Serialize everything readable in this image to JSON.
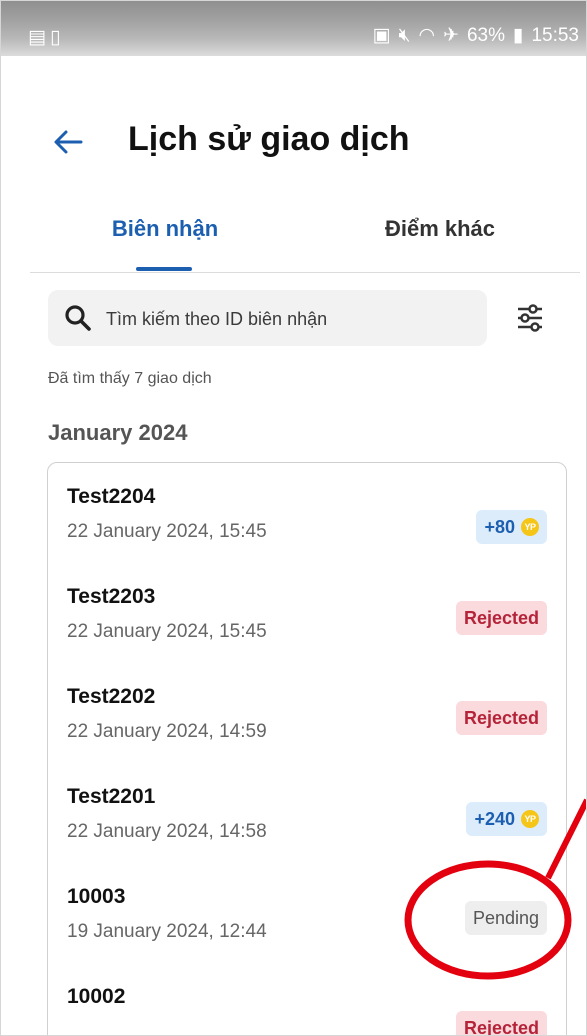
{
  "status_bar": {
    "left_icons": [
      "teams-icon",
      "sim-icon"
    ],
    "battery": "63%",
    "time": "15:53"
  },
  "header": {
    "title": "Lịch sử giao dịch"
  },
  "tabs": [
    {
      "label": "Biên nhận",
      "active": true
    },
    {
      "label": "Điểm khác",
      "active": false
    }
  ],
  "search": {
    "placeholder": "Tìm kiếm theo ID biên nhận",
    "value": ""
  },
  "result_count": "Đã tìm thấy 7 giao dịch",
  "month_heading": "January 2024",
  "transactions": [
    {
      "id": "Test2204",
      "date": "22 January 2024, 15:45",
      "status": "+80",
      "type": "points"
    },
    {
      "id": "Test2203",
      "date": "22 January 2024, 15:45",
      "status": "Rejected",
      "type": "rejected"
    },
    {
      "id": "Test2202",
      "date": "22 January 2024, 14:59",
      "status": "Rejected",
      "type": "rejected"
    },
    {
      "id": "Test2201",
      "date": "22 January 2024, 14:58",
      "status": "+240",
      "type": "points"
    },
    {
      "id": "10003",
      "date": "19 January 2024, 12:44",
      "status": "Pending",
      "type": "pending"
    },
    {
      "id": "10002",
      "date": "",
      "status": "Rejected",
      "type": "rejected"
    }
  ],
  "coin_label": "YP",
  "colors": {
    "accent": "#1c5fb0",
    "rejected_bg": "#fadadd",
    "rejected_text": "#b42338",
    "points_bg": "#dcecfb",
    "pending_bg": "#eeeeee",
    "annotation": "#e3000f"
  }
}
